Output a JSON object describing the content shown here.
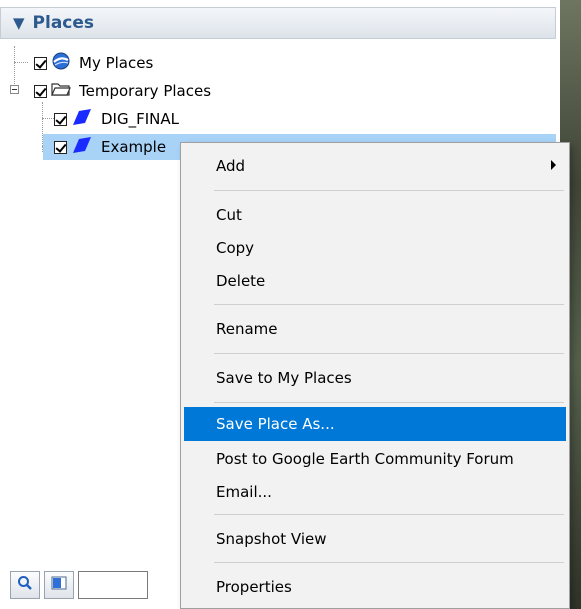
{
  "panel": {
    "title": "Places",
    "collapse_glyph": "▼"
  },
  "tree": {
    "items": [
      {
        "label": "My Places",
        "checked": true,
        "icon": "google-earth-globe-icon"
      },
      {
        "label": "Temporary Places",
        "checked": true,
        "icon": "folder-icon"
      },
      {
        "label": "DIG_FINAL",
        "checked": true,
        "icon": "polygon-icon"
      },
      {
        "label": "Example",
        "checked": true,
        "icon": "polygon-icon",
        "selected": true
      }
    ]
  },
  "toolbar": {
    "search_icon": "magnifier-icon",
    "panel_toggle_icon": "panel-toggle-icon",
    "search_value": ""
  },
  "context_menu": {
    "items": [
      {
        "label": "Add",
        "has_submenu": true
      },
      {
        "label": "Cut"
      },
      {
        "label": "Copy"
      },
      {
        "label": "Delete"
      },
      {
        "label": "Rename"
      },
      {
        "label": "Save to My Places"
      },
      {
        "label": "Save Place As...",
        "highlighted": true
      },
      {
        "label": "Post to Google Earth Community Forum"
      },
      {
        "label": "Email..."
      },
      {
        "label": "Snapshot View"
      },
      {
        "label": "Properties"
      }
    ]
  },
  "colors": {
    "header_text": "#2c5a8f",
    "selection": "#a8d3f7",
    "menu_highlight": "#0078d7",
    "polygon_blue": "#1a2bff"
  }
}
